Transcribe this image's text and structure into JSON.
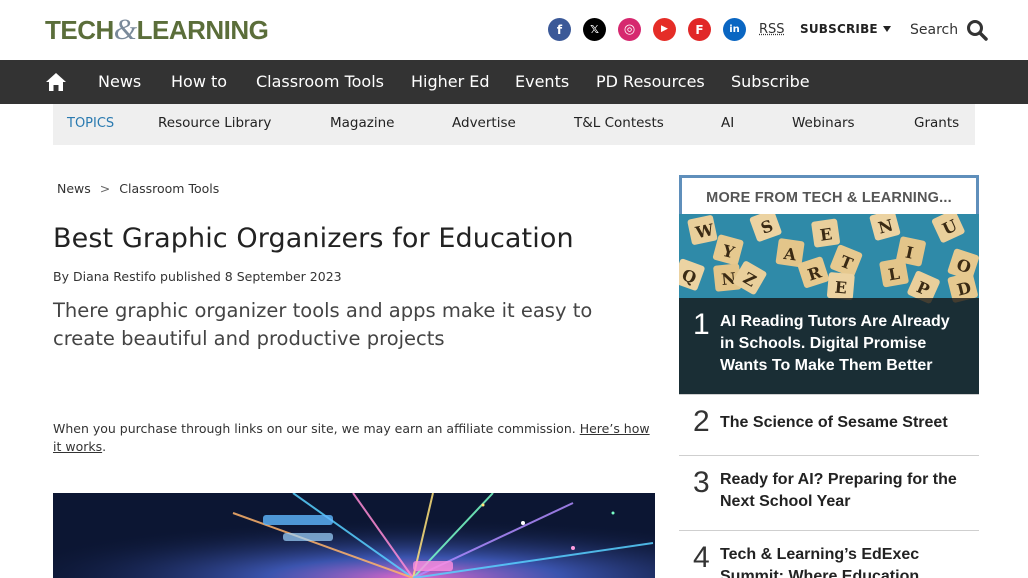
{
  "header": {
    "logo_left": "TECH",
    "logo_amp": "&",
    "logo_right": "LEARNING",
    "rss": "RSS",
    "subscribe": "SUBSCRIBE",
    "search": "Search"
  },
  "socials": [
    {
      "icon": "facebook-icon",
      "glyph": "f",
      "color": "#3b5998"
    },
    {
      "icon": "x-icon",
      "glyph": "𝕏",
      "color": "#000000"
    },
    {
      "icon": "instagram-icon",
      "glyph": "◎",
      "color": "#d6286f"
    },
    {
      "icon": "youtube-icon",
      "glyph": "▶",
      "color": "#e52d27"
    },
    {
      "icon": "flipboard-icon",
      "glyph": "F",
      "color": "#e12828"
    },
    {
      "icon": "linkedin-icon",
      "glyph": "in",
      "color": "#0a66c2"
    }
  ],
  "nav": {
    "home_icon": "home-icon",
    "items": [
      "News",
      "How to",
      "Classroom Tools",
      "Higher Ed",
      "Events",
      "PD Resources",
      "Subscribe"
    ]
  },
  "topics": {
    "label": "TOPICS",
    "items": [
      "Resource Library",
      "Magazine",
      "Advertise",
      "T&L Contests",
      "AI",
      "Webinars",
      "Grants"
    ]
  },
  "article": {
    "breadcrumb": [
      "News",
      "Classroom Tools"
    ],
    "breadcrumb_sep": ">",
    "title": "Best Graphic Organizers for Education",
    "byline_prefix": "By",
    "author": "Diana Restifo",
    "published": "published 8 September 2023",
    "strapline": "There graphic organizer tools and apps make it easy to create beautiful and productive projects",
    "affiliate_text": "When you purchase through links on our site, we may earn an affiliate commission.",
    "affiliate_link": "Here’s how it works",
    "affiliate_end": "."
  },
  "sidebar": {
    "heading": "MORE FROM TECH & LEARNING...",
    "items": [
      {
        "rank": "1",
        "title": "AI Reading Tutors Are Already in Schools. Digital Promise Wants To Make Them Better"
      },
      {
        "rank": "2",
        "title": "The Science of Sesame Street"
      },
      {
        "rank": "3",
        "title": "Ready for AI? Preparing for the Next School Year"
      },
      {
        "rank": "4",
        "title": "Tech & Learning’s EdExec Summit: Where Education"
      }
    ]
  },
  "colors": {
    "nav_bg": "#333333",
    "topics_bg": "#efefef",
    "topics_label": "#2a7ab0",
    "sidebar_border": "#5f8fbb",
    "logo_green": "#5b6e3a"
  }
}
